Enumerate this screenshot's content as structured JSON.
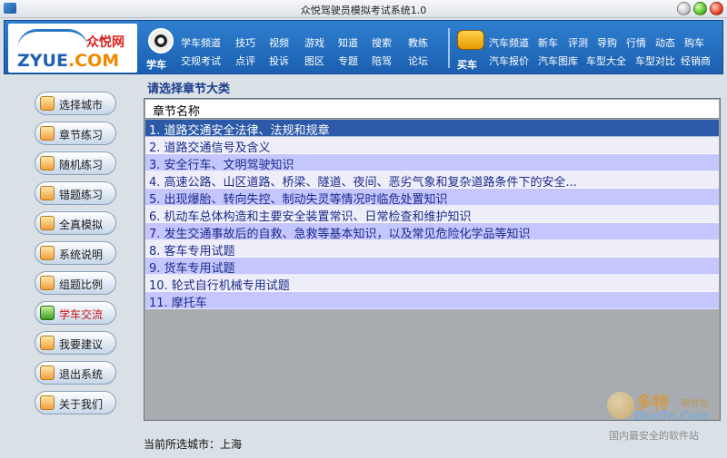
{
  "window": {
    "title": "众悦驾驶员模拟考试系统1.0"
  },
  "logo": {
    "cn": "众悦网",
    "en_prefix": "ZYUE",
    "en_suffix": ".COM"
  },
  "nav": {
    "xueche": "学车",
    "maiche": "买车",
    "group1_row1": [
      "学车频道",
      "技巧",
      "视频",
      "游戏",
      "知道",
      "搜索",
      "教练"
    ],
    "group1_row2": [
      "交规考试",
      "点评",
      "投诉",
      "图区",
      "专题",
      "陪驾",
      "论坛"
    ],
    "group2_row1": [
      "汽车频道",
      "新车",
      "评测",
      "导购",
      "行情",
      "动态",
      "购车"
    ],
    "group2_row2": [
      "汽车报价",
      "汽车图库",
      "车型大全",
      "车型对比",
      "经销商"
    ]
  },
  "sidebar": {
    "items": [
      {
        "label": "选择城市"
      },
      {
        "label": "章节练习"
      },
      {
        "label": "随机练习"
      },
      {
        "label": "错题练习"
      },
      {
        "label": "全真模拟"
      },
      {
        "label": "系统说明"
      },
      {
        "label": "组题比例"
      },
      {
        "label": "学车交流"
      },
      {
        "label": "我要建议"
      },
      {
        "label": "退出系统"
      },
      {
        "label": "关于我们"
      }
    ],
    "active_index": 7
  },
  "main": {
    "section_title": "请选择章节大类",
    "column_header": "章节名称",
    "selected_index": 0,
    "rows": [
      "1.  道路交通安全法律、法规和规章",
      "2.  道路交通信号及含义",
      "3.  安全行车、文明驾驶知识",
      "4.  高速公路、山区道路、桥梁、隧道、夜间、恶劣气象和复杂道路条件下的安全...",
      "5.  出现爆胎、转向失控、制动失灵等情况时临危处置知识",
      "6.  机动车总体构造和主要安全装置常识、日常检查和维护知识",
      "7.  发生交通事故后的自救、急救等基本知识，以及常见危险化学品等知识",
      "8.  客车专用试题",
      "9.  货车专用试题",
      "10.  轮式自行机械专用试题",
      "11.  摩托车"
    ]
  },
  "footer": {
    "current_city": "当前所选城市：上海"
  },
  "watermark": {
    "brand": "多特",
    "brand_suffix": "软件站",
    "domain": "DuoTe.Com",
    "slogan": "国内最安全的软件站"
  },
  "colors": {
    "header_blue": "#1b5fb0",
    "selected_row": "#2d5aa8",
    "odd_row": "#c6c6ff",
    "even_row": "#eeeef8"
  }
}
